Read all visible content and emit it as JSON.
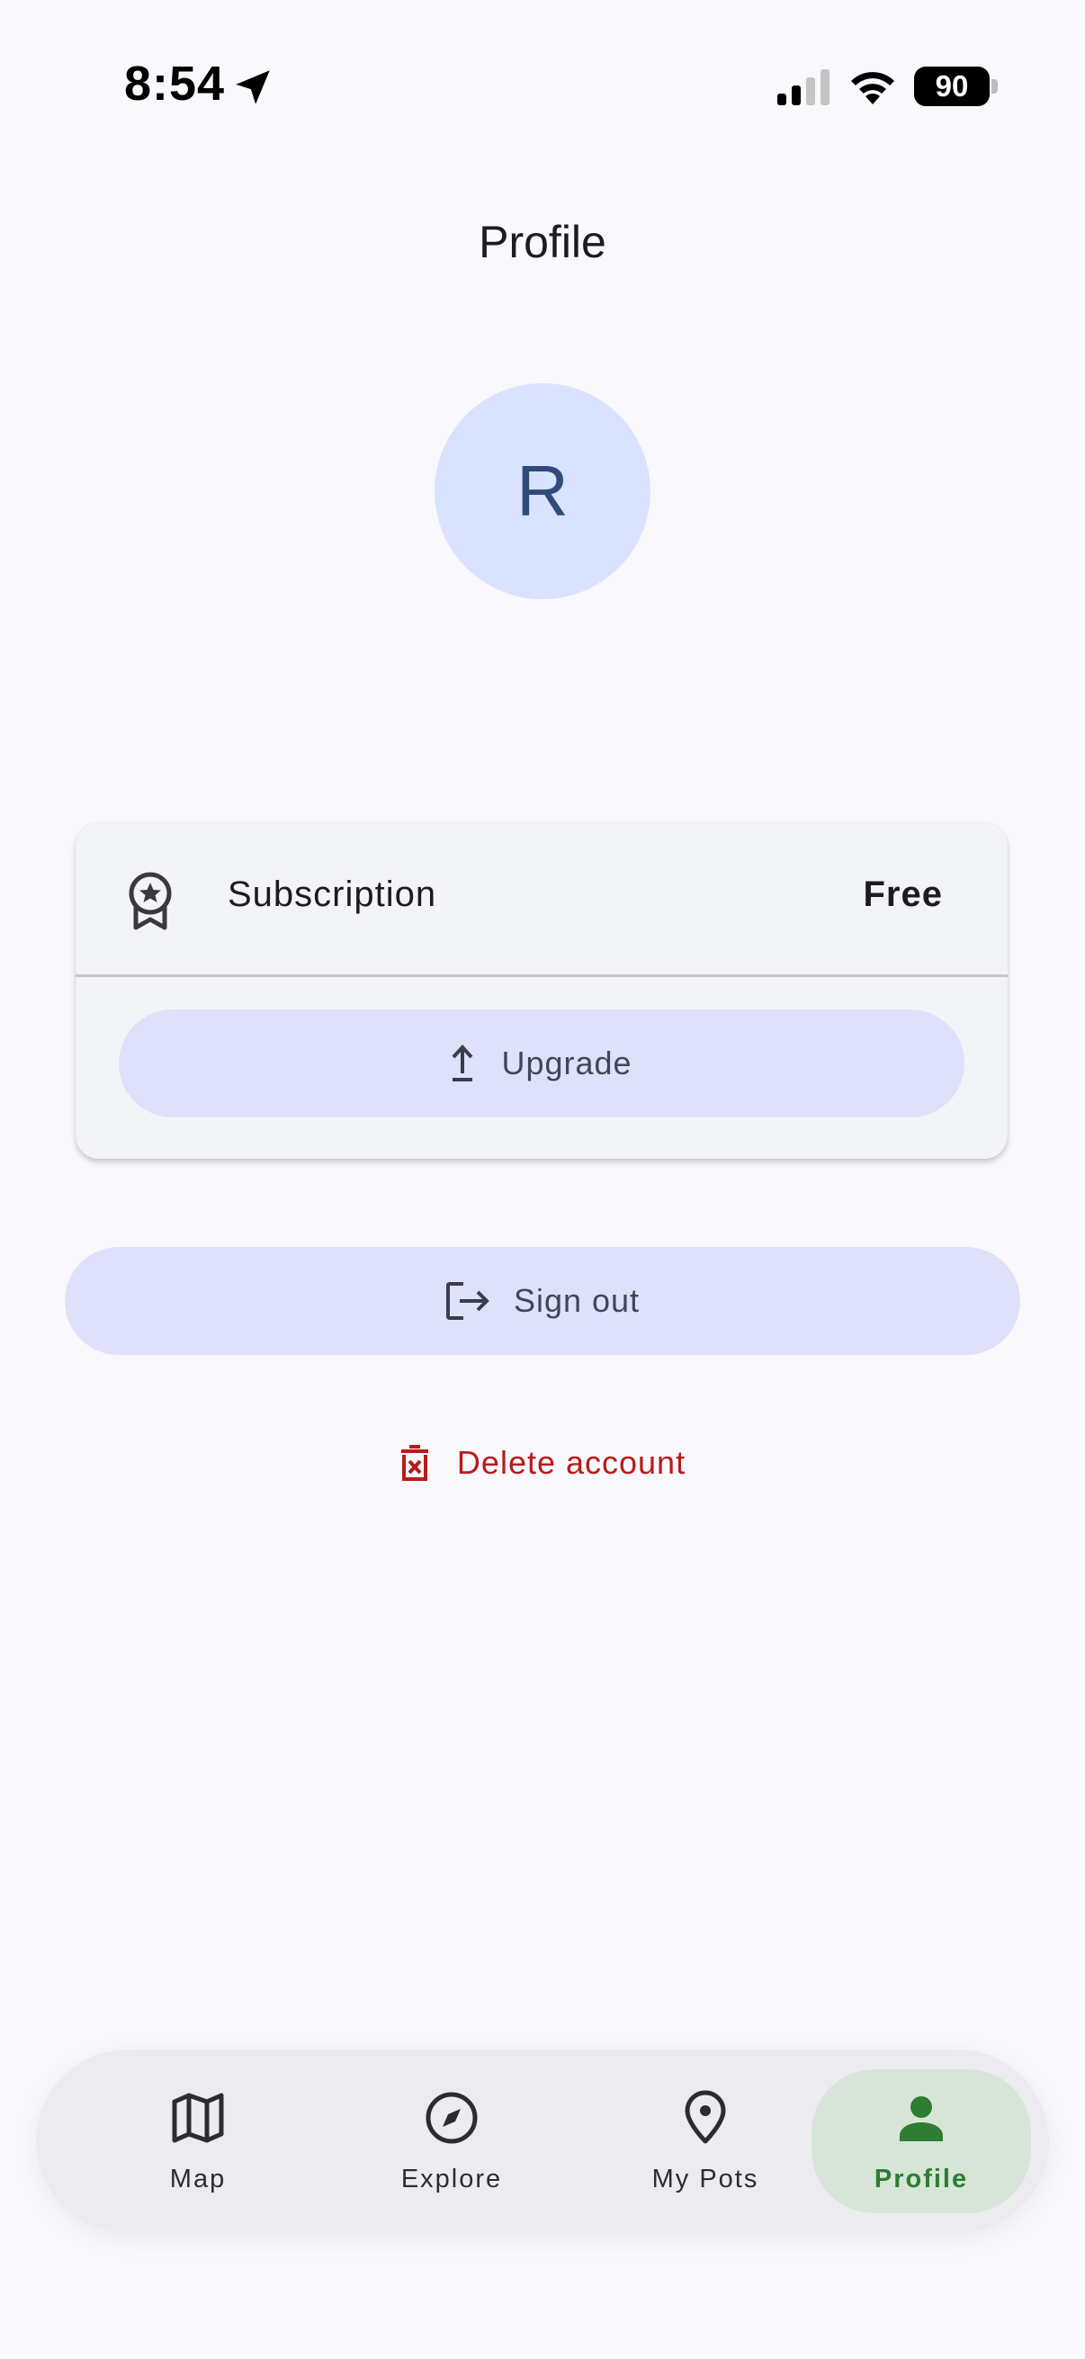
{
  "status_bar": {
    "time": "8:54",
    "battery": "90"
  },
  "page": {
    "title": "Profile"
  },
  "avatar": {
    "initial": "R",
    "bg": "#d9e2ff"
  },
  "subscription": {
    "label": "Subscription",
    "value": "Free",
    "upgrade_label": "Upgrade"
  },
  "actions": {
    "sign_out_label": "Sign out",
    "delete_label": "Delete account"
  },
  "nav": {
    "items": [
      {
        "label": "Map",
        "icon": "map-icon"
      },
      {
        "label": "Explore",
        "icon": "compass-icon"
      },
      {
        "label": "My Pots",
        "icon": "location-pin-icon"
      },
      {
        "label": "Profile",
        "icon": "person-icon",
        "active": true
      }
    ]
  },
  "colors": {
    "accent_green": "#2e7d32",
    "danger": "#ba1a1a",
    "button_bg": "#dee1f9"
  }
}
